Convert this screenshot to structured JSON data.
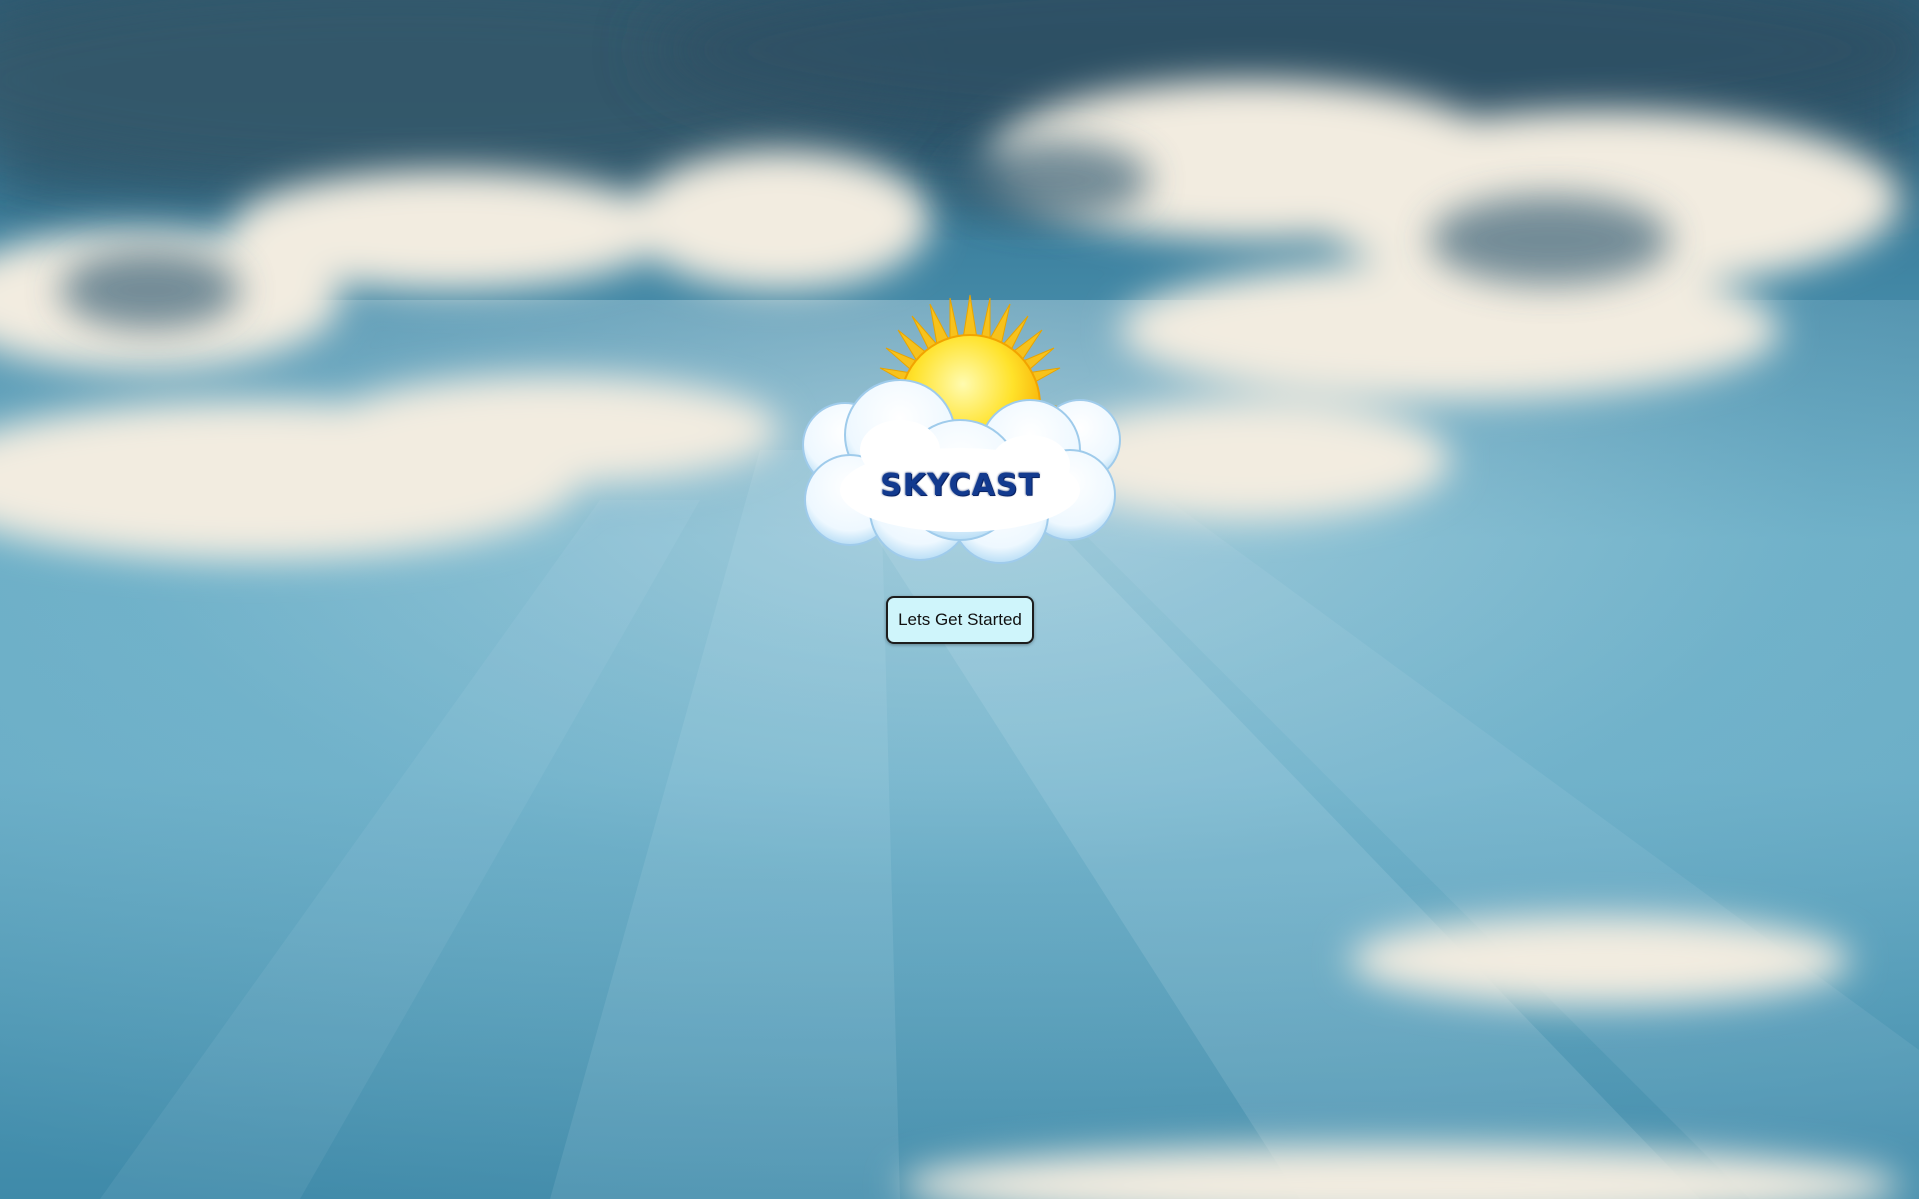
{
  "app": {
    "logo_text": "SKYCAST",
    "logo_icon": "sun-cloud-logo-icon"
  },
  "landing": {
    "start_button_label": "Lets Get Started"
  },
  "colors": {
    "sky": "#5fa7c2",
    "button_bg": "#cff5fb",
    "logo_text": "#123a8f",
    "sun": "#ffd21a"
  }
}
